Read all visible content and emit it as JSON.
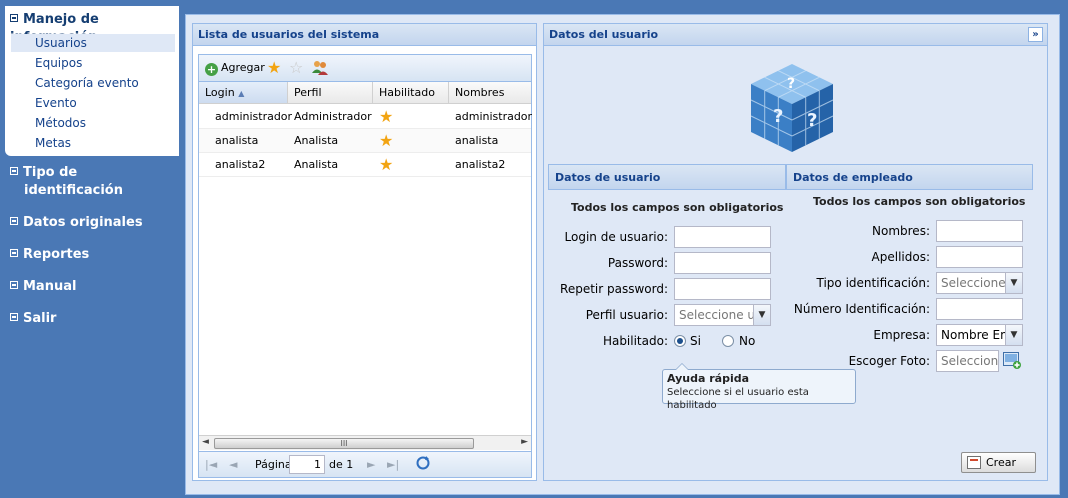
{
  "nav": {
    "sections": [
      {
        "label": "Manejo de información",
        "expanded": true
      },
      {
        "label": "Tipo de identificación"
      },
      {
        "label": "Datos originales"
      },
      {
        "label": "Reportes"
      },
      {
        "label": "Manual"
      },
      {
        "label": "Salir"
      }
    ],
    "subitems": [
      {
        "label": "Usuarios",
        "selected": true
      },
      {
        "label": "Equipos"
      },
      {
        "label": "Categoría evento"
      },
      {
        "label": "Evento"
      },
      {
        "label": "Métodos"
      },
      {
        "label": "Metas"
      }
    ]
  },
  "grid_panel": {
    "title": "Lista de usuarios del sistema",
    "toolbar": {
      "add_label": "Agregar",
      "icons": [
        "star-icon",
        "star-empty-icon",
        "users-icon"
      ]
    },
    "columns": [
      "Login",
      "Perfil",
      "Habilitado",
      "Nombres"
    ],
    "sorted_column": "Login",
    "rows": [
      {
        "login": "administrador",
        "perfil": "Administrador",
        "habilitado": "star-icon",
        "nombres": "administrador"
      },
      {
        "login": "analista",
        "perfil": "Analista",
        "habilitado": "star-icon",
        "nombres": "analista"
      },
      {
        "login": "analista2",
        "perfil": "Analista",
        "habilitado": "star-icon",
        "nombres": "analista2"
      }
    ],
    "scroll_thumb_label": "III",
    "pager": {
      "page_label": "Página",
      "page_value": "1",
      "of_label": "de 1"
    }
  },
  "detail_panel": {
    "title": "Datos del usuario",
    "collapse_glyph": "»",
    "user_section": {
      "title": "Datos de usuario",
      "required_note": "Todos los campos son obligatorios",
      "login_label": "Login de usuario:",
      "password_label": "Password:",
      "repeat_password_label": "Repetir password:",
      "profile_label": "Perfil usuario:",
      "profile_value": "Seleccione ur",
      "enabled_label": "Habilitado:",
      "enabled_yes": "Si",
      "enabled_no": "No",
      "enabled_selected": "Si"
    },
    "employee_section": {
      "title": "Datos de empleado",
      "required_note": "Todos los campos son obligatorios",
      "names_label": "Nombres:",
      "surnames_label": "Apellidos:",
      "id_type_label": "Tipo identificación:",
      "id_type_value": "Seleccione",
      "id_number_label": "Número Identificación:",
      "company_label": "Empresa:",
      "company_value": "Nombre Em",
      "photo_label": "Escoger Foto:",
      "photo_value": "Seleccione"
    },
    "tooltip": {
      "title": "Ayuda rápida",
      "body": "Seleccione si el usuario esta habilitado"
    },
    "create_button": "Crear"
  },
  "colors": {
    "background": "#4a78b5",
    "panel_border": "#99bbe8",
    "header_text": "#15428b",
    "panel_bg": "#dfe8f6"
  }
}
